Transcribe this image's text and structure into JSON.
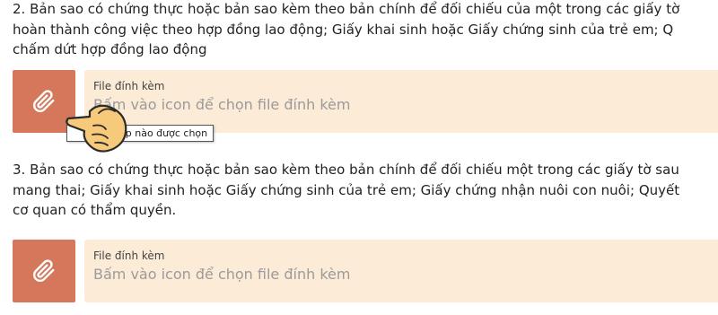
{
  "items": [
    {
      "lines": [
        "2. Bản sao có chứng thực hoặc bản sao kèm theo bản chính để đối chiếu của một trong các giấy tờ",
        "hoàn thành công việc theo hợp đồng lao động; Giấy khai sinh hoặc Giấy chứng sinh của trẻ em; Q",
        "chấm dứt hợp đồng lao động"
      ],
      "attachment": {
        "icon": "paperclip-icon",
        "label": "File đính kèm",
        "placeholder": "Bấm vào icon để chọn file đính kèm"
      }
    },
    {
      "lines": [
        "3. Bản sao có chứng thực hoặc bản sao kèm theo bản chính để đối chiếu một trong các giấy tờ sau",
        "mang thai; Giấy khai sinh hoặc Giấy chứng sinh của trẻ em; Giấy chứng nhận nuôi con nuôi; Quyết",
        "cơ quan có thẩm quyền."
      ],
      "attachment": {
        "icon": "paperclip-icon",
        "label": "File đính kèm",
        "placeholder": "Bấm vào icon để chọn file đính kèm"
      }
    }
  ],
  "tooltip": {
    "text": "ệp nào được chọn"
  },
  "colors": {
    "attach_button": "#d4775a",
    "field_background": "#fcebd6",
    "placeholder_text": "#9b9b9b"
  }
}
